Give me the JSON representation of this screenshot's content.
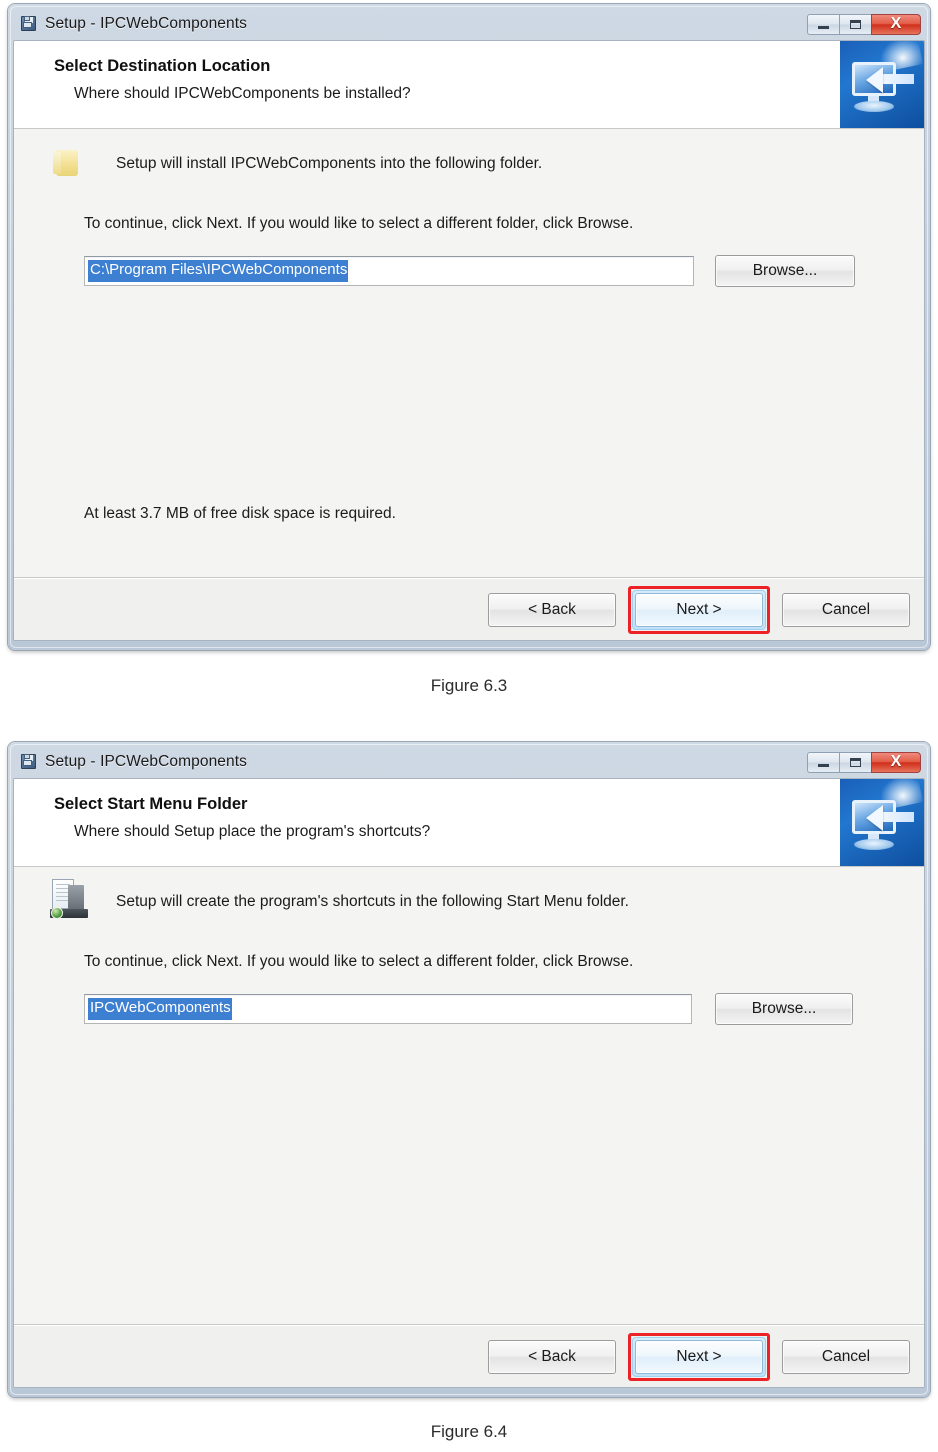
{
  "page": {
    "figure_1_caption": "Figure 6.3",
    "figure_2_caption": "Figure 6.4"
  },
  "colors": {
    "title_bar_start": "#cfd9e4",
    "title_bar_end": "#b9c7d7",
    "close_button_red": "#cf2f1c",
    "selection_blue": "#3d7fd1",
    "annotation_red": "#ec2227",
    "banner_blue": "#1a5fb8",
    "client_background": "#f4f4f2"
  },
  "dialog1": {
    "titlebar": {
      "icon": "setup-disk-icon",
      "title": "Setup - IPCWebComponents",
      "minimize_label": "Minimize",
      "maximize_label": "Maximize",
      "close_label": "X"
    },
    "header": {
      "title": "Select Destination Location",
      "subtitle": "Where should IPCWebComponents be installed?",
      "banner_icon": "monitor-arrow-icon"
    },
    "body": {
      "icon": "folder-icon",
      "intro_text": "Setup will install IPCWebComponents into the following folder.",
      "instruction_text": "To continue, click Next. If you would like to select a different folder, click Browse.",
      "path_value": "C:\\Program Files\\IPCWebComponents",
      "path_selected": true,
      "browse_label": "Browse...",
      "disk_space_text": "At least 3.7 MB of free disk space is required."
    },
    "footer": {
      "back_label": "< Back",
      "next_label": "Next >",
      "cancel_label": "Cancel",
      "highlighted_button": "Next >"
    }
  },
  "dialog2": {
    "titlebar": {
      "icon": "setup-disk-icon",
      "title": "Setup - IPCWebComponents",
      "minimize_label": "Minimize",
      "maximize_label": "Maximize",
      "close_label": "X"
    },
    "header": {
      "title": "Select Start Menu Folder",
      "subtitle": "Where should Setup place the program's shortcuts?",
      "banner_icon": "monitor-arrow-icon"
    },
    "body": {
      "icon": "start-menu-icon",
      "intro_text": "Setup will create the program's shortcuts in the following Start Menu folder.",
      "instruction_text": "To continue, click Next. If you would like to select a different folder, click Browse.",
      "folder_value": "IPCWebComponents",
      "folder_selected": true,
      "browse_label": "Browse..."
    },
    "footer": {
      "back_label": "< Back",
      "next_label": "Next >",
      "cancel_label": "Cancel",
      "highlighted_button": "Next >"
    }
  }
}
